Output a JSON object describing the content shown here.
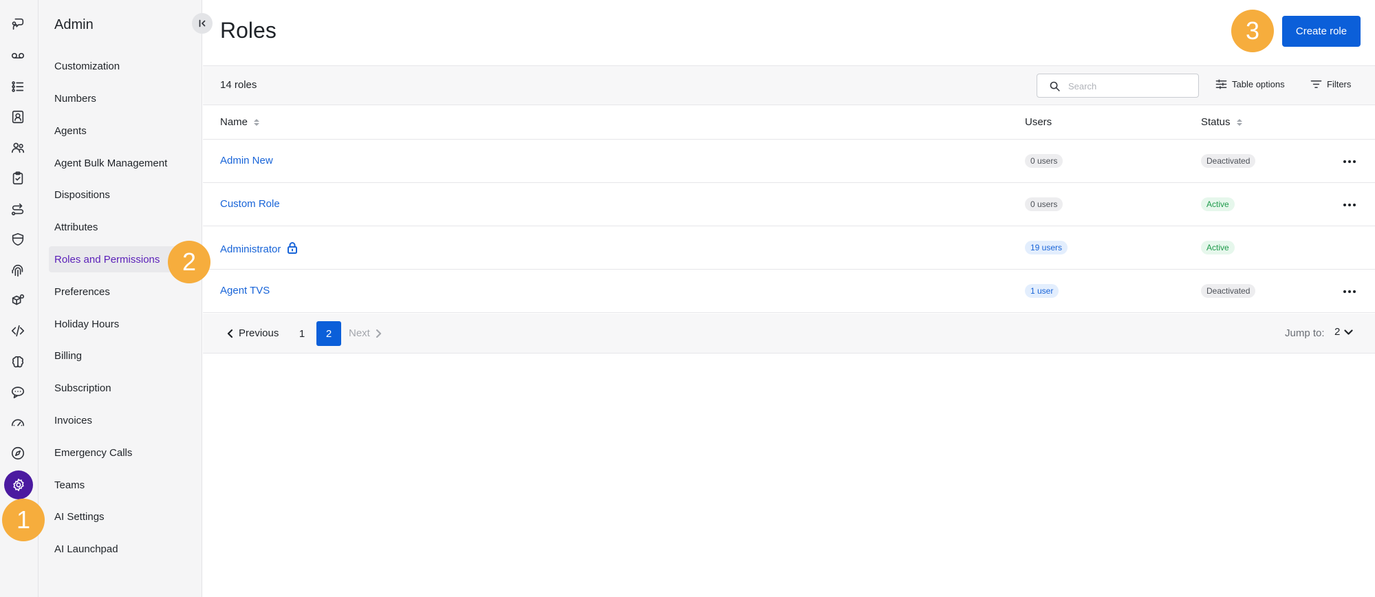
{
  "rail": {
    "icons": [
      "feedback-icon",
      "voicemail-icon",
      "list-icon",
      "contacts-icon",
      "team-icon",
      "clipboard-icon",
      "routing-icon",
      "shield-icon",
      "fingerprint-icon",
      "integrations-icon",
      "code-icon",
      "brain-icon",
      "chat-icon",
      "dashboard-icon",
      "compass-icon",
      "gear-icon"
    ],
    "active": "gear-icon"
  },
  "sidebar": {
    "title": "Admin",
    "items": [
      {
        "label": "Customization"
      },
      {
        "label": "Numbers"
      },
      {
        "label": "Agents"
      },
      {
        "label": "Agent Bulk Management"
      },
      {
        "label": "Dispositions"
      },
      {
        "label": "Attributes"
      },
      {
        "label": "Roles and Permissions",
        "active": true
      },
      {
        "label": "Preferences"
      },
      {
        "label": "Holiday Hours"
      },
      {
        "label": "Billing"
      },
      {
        "label": "Subscription"
      },
      {
        "label": "Invoices"
      },
      {
        "label": "Emergency Calls"
      },
      {
        "label": "Teams"
      },
      {
        "label": "AI Settings"
      },
      {
        "label": "AI Launchpad"
      }
    ]
  },
  "steps": {
    "one": "1",
    "two": "2",
    "three": "3"
  },
  "main": {
    "title": "Roles",
    "create_button": "Create role",
    "toolbar": {
      "count": "14 roles",
      "search_placeholder": "Search",
      "table_options": "Table options",
      "filters": "Filters"
    },
    "columns": {
      "name": "Name",
      "users": "Users",
      "status": "Status"
    },
    "rows": [
      {
        "name": "Admin New",
        "users": "0 users",
        "status": "Deactivated"
      },
      {
        "name": "Custom Role",
        "users": "0 users",
        "status": "Active"
      },
      {
        "name": "Administrator",
        "users": "19 users",
        "status": "Active"
      },
      {
        "name": "Agent TVS",
        "users": "1 user",
        "status": "Deactivated"
      }
    ],
    "pagination": {
      "previous": "Previous",
      "pages": [
        "1",
        "2"
      ],
      "current_page": "2",
      "next": "Next",
      "jump_label": "Jump to:",
      "jump_value": "2"
    }
  },
  "colors": {
    "accent": "#0b5fd9",
    "rail_active": "#4b1aa0",
    "nav_active_text": "#5a1fb8",
    "step_marker": "#f6ad3d",
    "link": "#1864d8",
    "active_status": "#1e9a4b"
  }
}
